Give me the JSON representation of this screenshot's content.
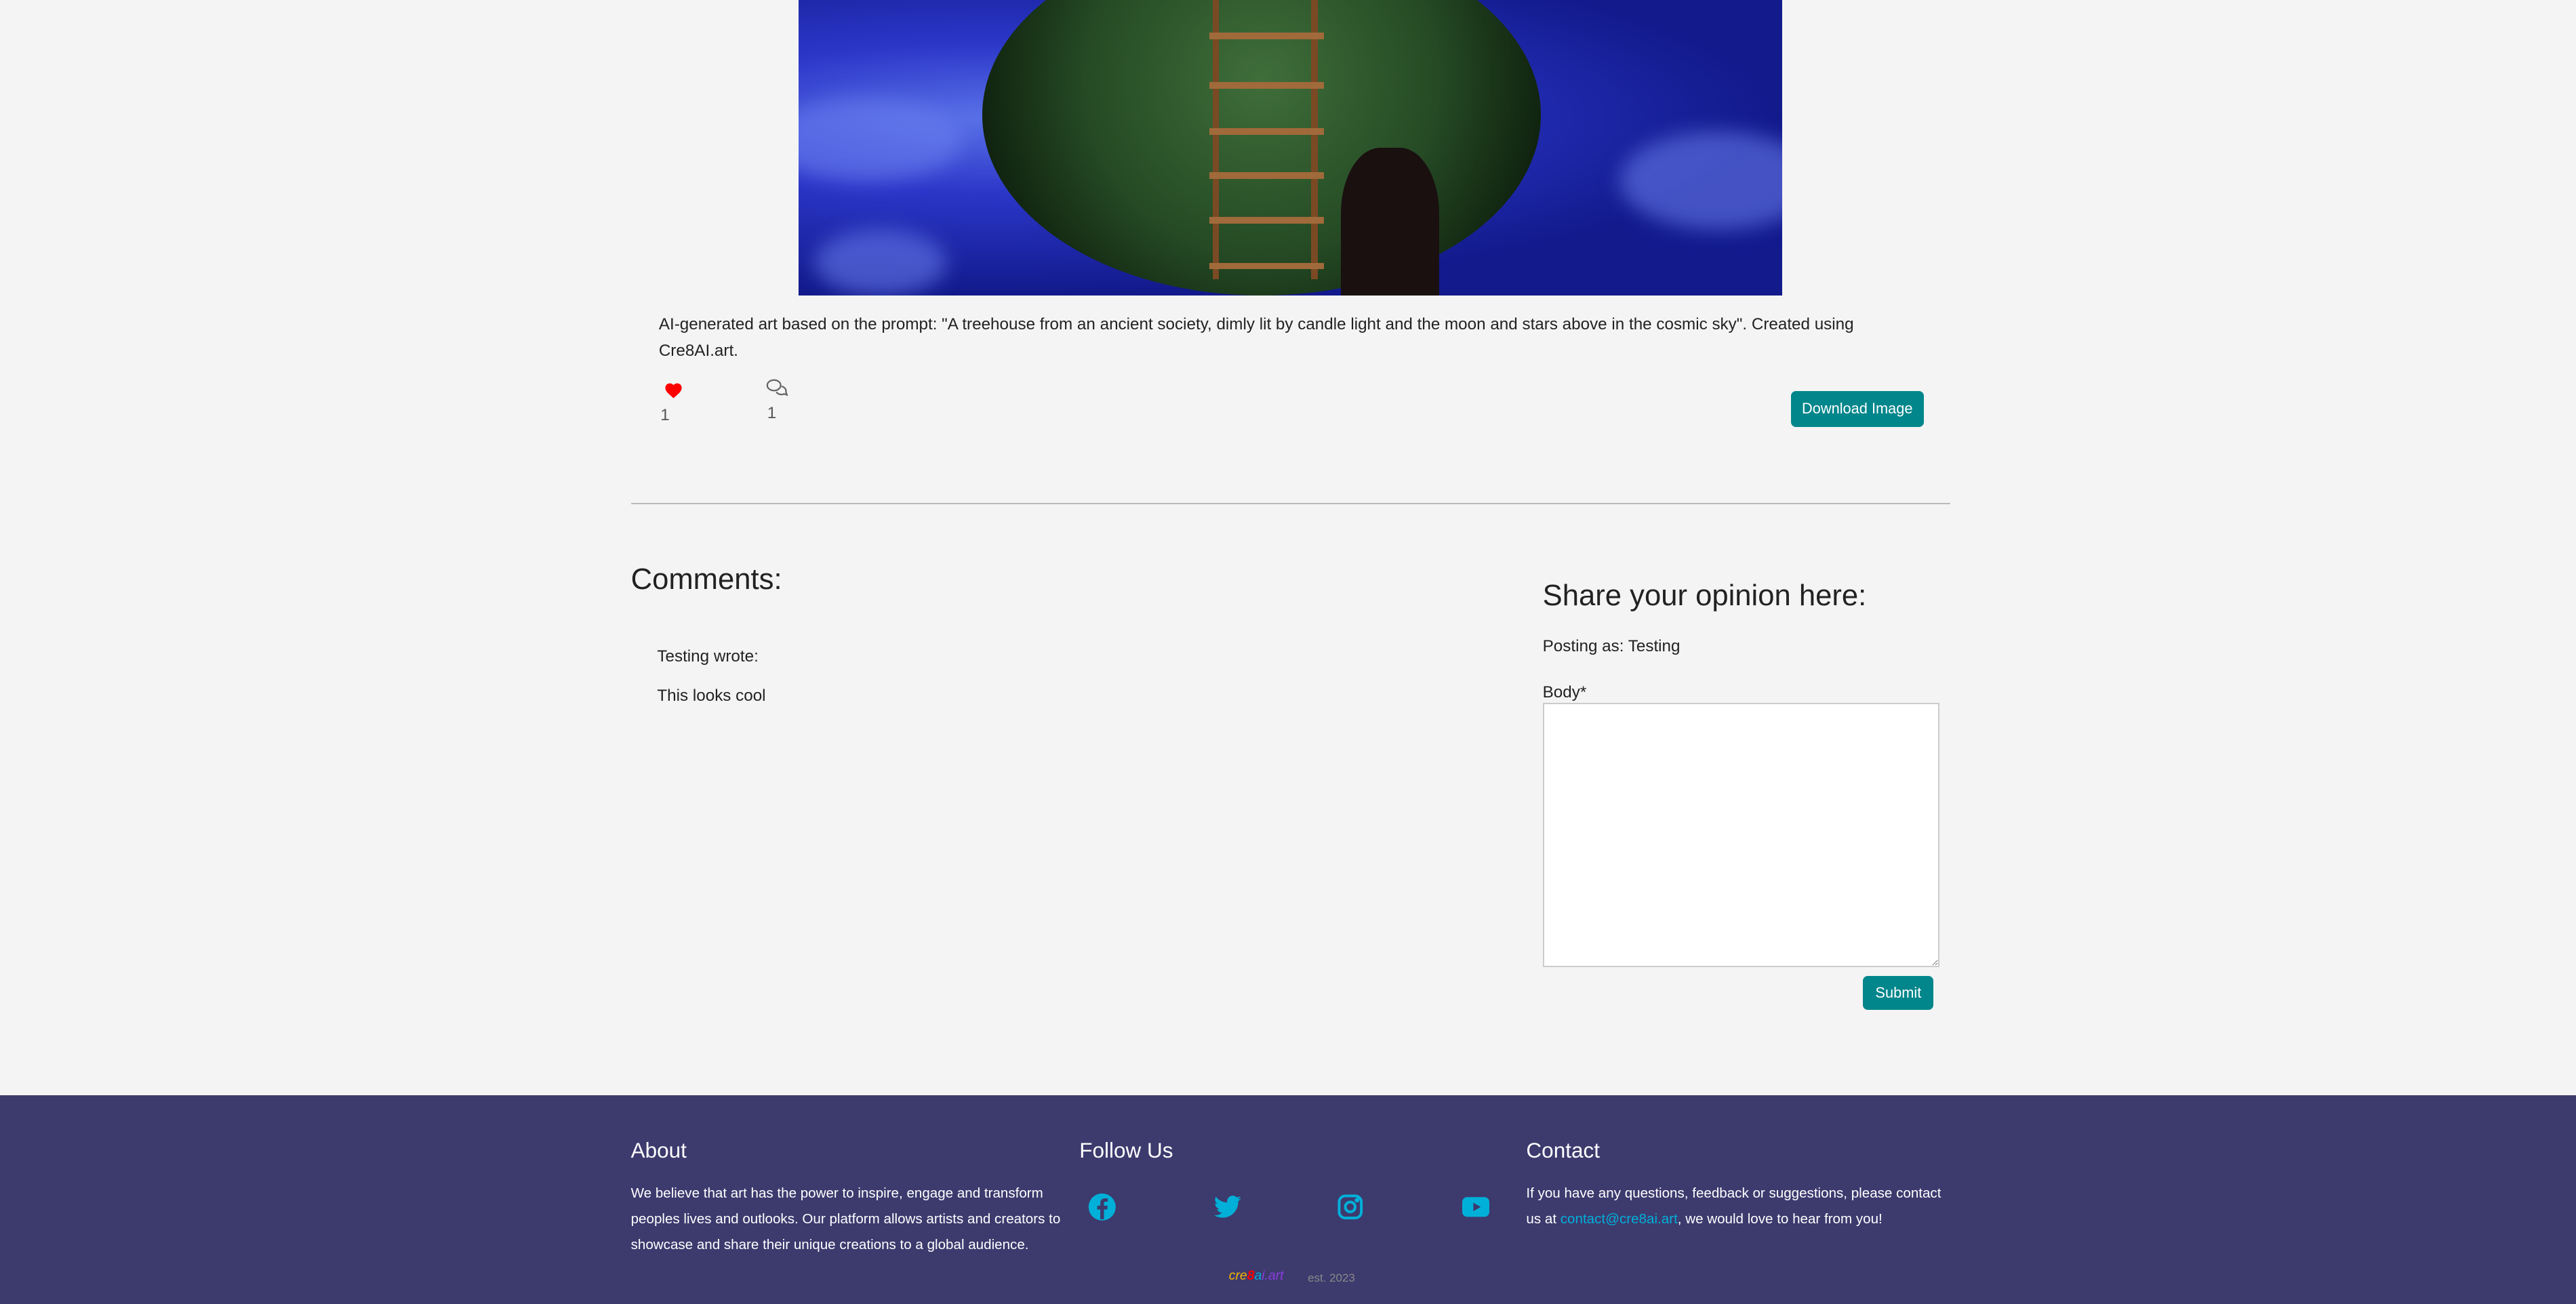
{
  "post": {
    "caption": "AI-generated art based on the prompt: \"A treehouse from an ancient society, dimly lit by candle light and the moon and stars above in the cosmic sky\". Created using Cre8AI.art.",
    "likes": "1",
    "comments_count": "1",
    "download_label": "Download Image",
    "like_color": "#ff0000",
    "accent": "#00868b"
  },
  "comments": {
    "title": "Comments:",
    "items": [
      {
        "author": "Testing wrote:",
        "body": "This looks cool"
      }
    ]
  },
  "form": {
    "title": "Share your opinion here:",
    "posting_as": "Posting as: Testing",
    "body_label": "Body*",
    "body_value": "",
    "submit_label": "Submit"
  },
  "footer": {
    "about_title": "About",
    "about_text": "We believe that art has the power to inspire, engage and transform peoples lives and outlooks. Our platform allows artists and creators to showcase and share their unique creations to a global audience.",
    "follow_title": "Follow Us",
    "social_icons": [
      "facebook-icon",
      "twitter-icon",
      "instagram-icon",
      "youtube-icon"
    ],
    "contact_title": "Contact",
    "contact_pre": "If you have any questions, feedback or suggestions, please contact us at ",
    "contact_email": "contact@cre8ai.art",
    "contact_post": ", we would love to hear from you!",
    "logo_text": "cre8ai.art",
    "est": "est. 2023",
    "background": "#3d3a6e",
    "icon_color": "#00b0d8"
  }
}
